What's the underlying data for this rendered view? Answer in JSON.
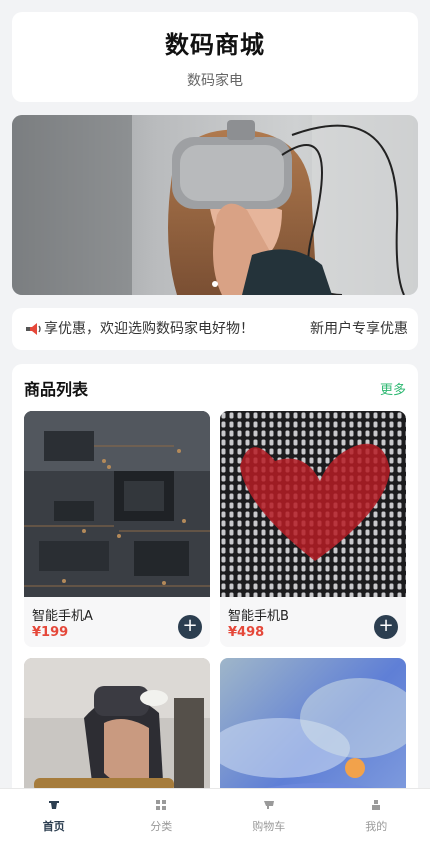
{
  "header": {
    "title": "数码商城",
    "subtitle": "数码家电"
  },
  "banner": {
    "active_index": 0,
    "dot_count": 1
  },
  "notice": {
    "icon": "megaphone-icon",
    "text_current": "享优惠，欢迎选购数码家电好物！",
    "text_next": "新用户专享优惠"
  },
  "products": {
    "title": "商品列表",
    "more_label": "更多",
    "items": [
      {
        "name": "智能手机A",
        "price": "¥199"
      },
      {
        "name": "智能手机B",
        "price": "¥498"
      },
      {
        "name": "",
        "price": ""
      },
      {
        "name": "",
        "price": ""
      }
    ],
    "add_label": "+"
  },
  "tabbar": {
    "items": [
      {
        "label": "首页",
        "icon": "home-icon",
        "active": true
      },
      {
        "label": "分类",
        "icon": "category-icon",
        "active": false
      },
      {
        "label": "购物车",
        "icon": "cart-icon",
        "active": false
      },
      {
        "label": "我的",
        "icon": "user-icon",
        "active": false
      }
    ]
  },
  "colors": {
    "accent": "#2eb872",
    "price": "#e5483a",
    "primary_dark": "#2c3e50"
  }
}
